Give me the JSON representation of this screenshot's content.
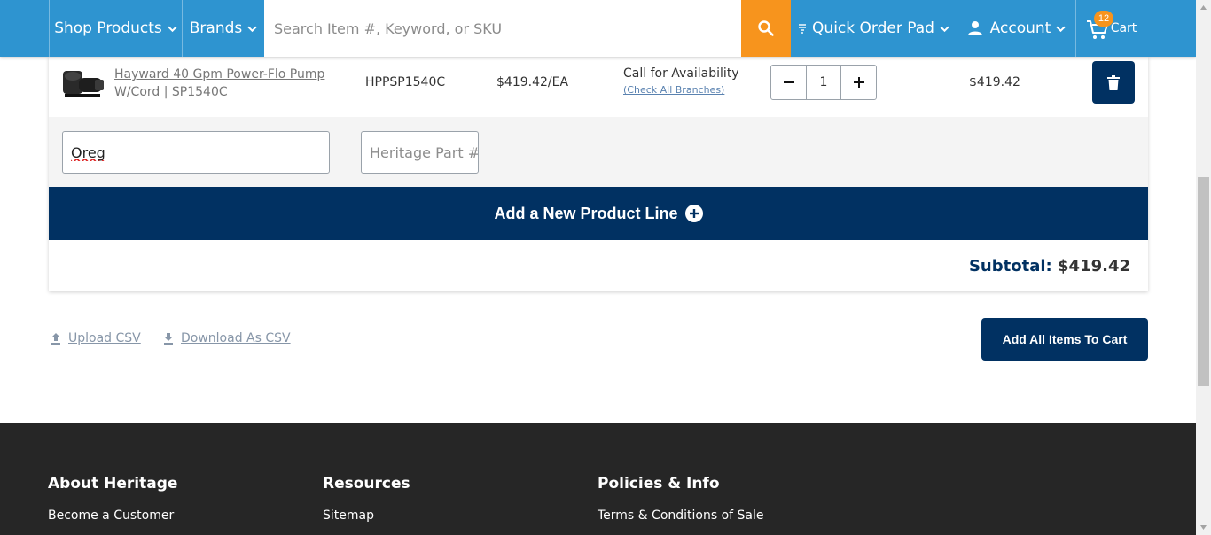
{
  "nav": {
    "shop_products": "Shop Products",
    "brands": "Brands",
    "search_placeholder": "Search Item #, Keyword, or SKU",
    "quick_order_pad": "Quick Order Pad",
    "account": "Account",
    "cart": "Cart",
    "cart_count": "12"
  },
  "order": {
    "item": {
      "name": "Hayward 40 Gpm Power-Flo Pump W/Cord | SP1540C",
      "sku": "HPPSP1540C",
      "unit_price": "$419.42/EA",
      "availability": "Call for Availability",
      "check_branches": "(Check All Branches)",
      "quantity": "1",
      "line_total": "$419.42"
    },
    "entry": {
      "search_value": "Oreg",
      "part_placeholder": "Heritage Part #"
    },
    "add_line_label": "Add a New Product Line",
    "subtotal_label": "Subtotal:",
    "subtotal_value": "$419.42"
  },
  "actions": {
    "upload_csv": "Upload CSV",
    "download_csv": "Download As CSV",
    "add_all": "Add All Items To Cart"
  },
  "footer": {
    "col1_head": "About Heritage",
    "col1_link": "Become a Customer",
    "col2_head": "Resources",
    "col2_link": "Sitemap",
    "col3_head": "Policies & Info",
    "col3_link": "Terms & Conditions of Sale"
  },
  "colors": {
    "nav_blue": "#2e94d0",
    "navy": "#013162",
    "orange": "#f7941d",
    "footer_bg": "#262626"
  }
}
